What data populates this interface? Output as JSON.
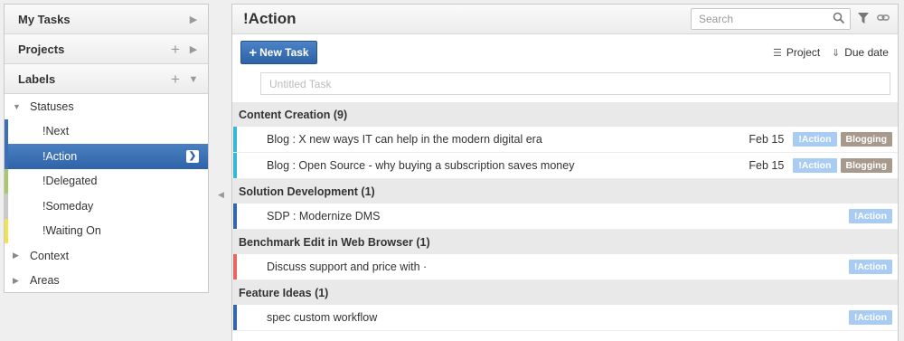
{
  "sidebar": {
    "my_tasks": "My Tasks",
    "projects": "Projects",
    "labels": "Labels",
    "tree": {
      "statuses": "Statuses",
      "items": [
        {
          "label": "!Next",
          "color": "#3a6fb8"
        },
        {
          "label": "!Action",
          "color": "#3a6fb8"
        },
        {
          "label": "!Delegated",
          "color": "#a9c86a"
        },
        {
          "label": "!Someday",
          "color": "#c9c9c9"
        },
        {
          "label": "!Waiting On",
          "color": "#f2e24e"
        }
      ],
      "context": "Context",
      "areas": "Areas"
    }
  },
  "main": {
    "title": "!Action",
    "search": {
      "placeholder": "Search"
    },
    "new_task_label": "New Task",
    "sort_project": "Project",
    "sort_due": "Due date",
    "new_task_placeholder": "Untitled Task",
    "groups": [
      {
        "name": "Content Creation (9)",
        "tasks": [
          {
            "title": "Blog : X new ways IT can help in the modern digital era",
            "date": "Feb 15",
            "bar": "#38b6d8",
            "tags": [
              "!Action",
              "Blogging"
            ]
          },
          {
            "title": "Blog : Open Source - why buying a subscription saves money",
            "date": "Feb 15",
            "bar": "#38b6d8",
            "tags": [
              "!Action",
              "Blogging"
            ]
          }
        ]
      },
      {
        "name": "Solution Development (1)",
        "tasks": [
          {
            "title": "SDP : Modernize DMS",
            "bar": "#3366b0",
            "tags": [
              "!Action"
            ]
          }
        ]
      },
      {
        "name": "Benchmark Edit in Web Browser (1)",
        "tasks": [
          {
            "title": "Discuss support and price with ·",
            "bar": "#e9665e",
            "tags": [
              "!Action"
            ]
          }
        ]
      },
      {
        "name": "Feature Ideas (1)",
        "tasks": [
          {
            "title": "spec custom workflow",
            "bar": "#3366b0",
            "tags": [
              "!Action"
            ]
          }
        ]
      }
    ]
  },
  "colors": {
    "action_tag": "#a9cdf2",
    "blogging_tag": "#a8998d",
    "accent": "#3a6fb8"
  }
}
